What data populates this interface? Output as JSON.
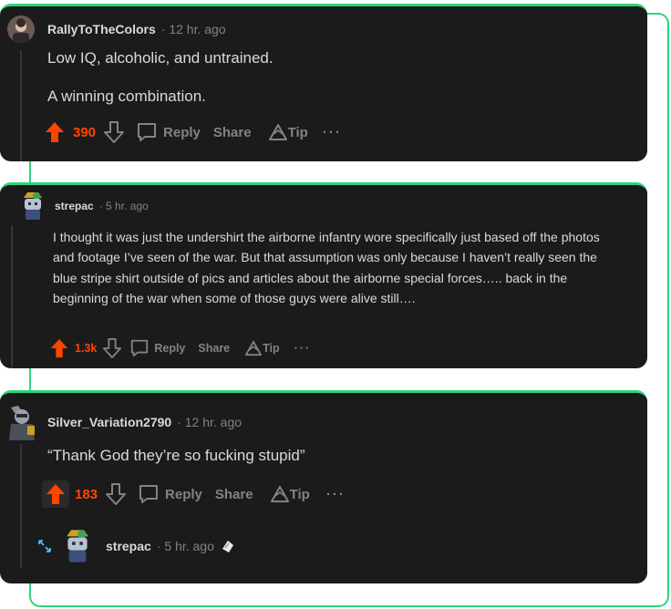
{
  "comments": [
    {
      "username": "RallyToTheColors",
      "time": "· 12 hr. ago",
      "paragraphs": [
        "Low IQ, alcoholic, and untrained.",
        "A winning combination."
      ],
      "votes": "390",
      "reply": "Reply",
      "share": "Share",
      "tip": "Tip",
      "more": "···"
    },
    {
      "username": "strepac",
      "time": "· 5 hr. ago",
      "paragraphs": [
        "I thought it was just the undershirt the airborne infantry wore specifically just based off the photos and footage I’ve seen of the war. But that assumption was only because I haven’t really seen the blue stripe shirt outside of pics and articles about the airborne special forces….. back in the beginning of the war when some of those guys were alive still…."
      ],
      "votes": "1.3k",
      "reply": "Reply",
      "share": "Share",
      "tip": "Tip",
      "more": "···"
    },
    {
      "username": "Silver_Variation2790",
      "time": "· 12 hr. ago",
      "paragraphs": [
        "“Thank God they’re so fucking stupid”"
      ],
      "votes": "183",
      "reply": "Reply",
      "share": "Share",
      "tip": "Tip",
      "more": "···"
    }
  ],
  "collapsed_reply": {
    "username": "strepac",
    "time": "· 5 hr. ago",
    "icons": [
      "expand-arrows-icon",
      "award-icon"
    ]
  },
  "colors": {
    "accent_green": "#2fd37a",
    "card_bg": "#1b1b1c",
    "upvote_orange": "#ff4500",
    "muted": "#818384"
  }
}
